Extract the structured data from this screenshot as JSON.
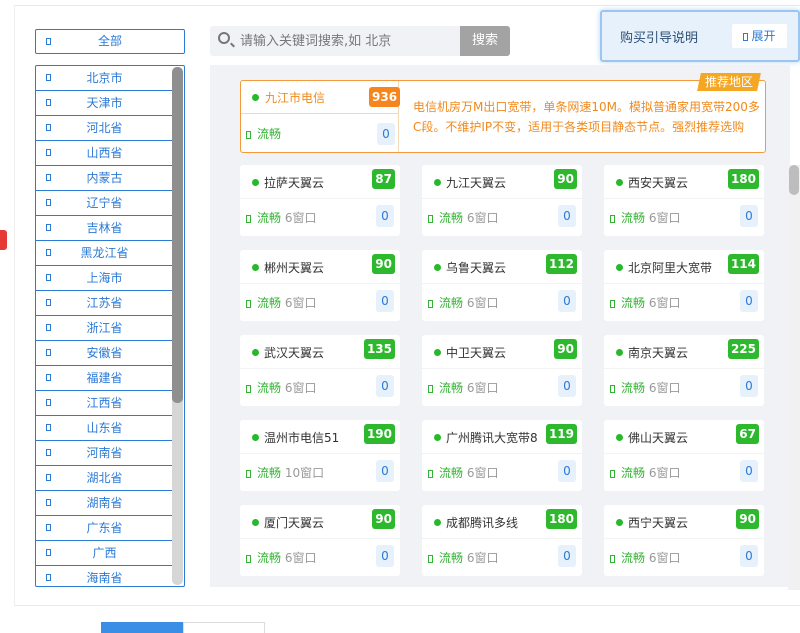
{
  "sidebar": {
    "all_label": "全部",
    "provinces": [
      "北京市",
      "天津市",
      "河北省",
      "山西省",
      "内蒙古",
      "辽宁省",
      "吉林省",
      "黑龙江省",
      "上海市",
      "江苏省",
      "浙江省",
      "安徽省",
      "福建省",
      "江西省",
      "山东省",
      "河南省",
      "湖北省",
      "湖南省",
      "广东省",
      "广西",
      "海南省"
    ]
  },
  "search": {
    "placeholder": "请输入关键词搜索,如 北京",
    "button_label": "搜索"
  },
  "guide": {
    "title": "购买引导说明",
    "expand_label": "展开"
  },
  "featured": {
    "badge": "推荐地区",
    "name": "九江市电信",
    "score": "936",
    "status": "流畅",
    "count": "0",
    "description": "电信机房万M出口宽带，单条网速10M。模拟普通家用宽带200多C段。不维护IP不变，适用于各类项目静态节点。强烈推荐选购"
  },
  "nodes": [
    {
      "name": "拉萨天翼云",
      "score": "87",
      "status": "流畅",
      "window": "6窗口",
      "count": "0"
    },
    {
      "name": "九江天翼云",
      "score": "90",
      "status": "流畅",
      "window": "6窗口",
      "count": "0"
    },
    {
      "name": "西安天翼云",
      "score": "180",
      "status": "流畅",
      "window": "6窗口",
      "count": "0"
    },
    {
      "name": "郴州天翼云",
      "score": "90",
      "status": "流畅",
      "window": "6窗口",
      "count": "0"
    },
    {
      "name": "乌鲁天翼云",
      "score": "112",
      "status": "流畅",
      "window": "6窗口",
      "count": "0"
    },
    {
      "name": "北京阿里大宽带",
      "score": "114",
      "status": "流畅",
      "window": "6窗口",
      "count": "0"
    },
    {
      "name": "武汉天翼云",
      "score": "135",
      "status": "流畅",
      "window": "6窗口",
      "count": "0"
    },
    {
      "name": "中卫天翼云",
      "score": "90",
      "status": "流畅",
      "window": "6窗口",
      "count": "0"
    },
    {
      "name": "南京天翼云",
      "score": "225",
      "status": "流畅",
      "window": "6窗口",
      "count": "0"
    },
    {
      "name": "温州市电信51",
      "score": "190",
      "status": "流畅",
      "window": "10窗口",
      "count": "0"
    },
    {
      "name": "广州腾讯大宽带8",
      "score": "119",
      "status": "流畅",
      "window": "6窗口",
      "count": "0"
    },
    {
      "name": "佛山天翼云",
      "score": "67",
      "status": "流畅",
      "window": "6窗口",
      "count": "0"
    },
    {
      "name": "厦门天翼云",
      "score": "90",
      "status": "流畅",
      "window": "6窗口",
      "count": "0"
    },
    {
      "name": "成都腾讯多线",
      "score": "180",
      "status": "流畅",
      "window": "6窗口",
      "count": "0"
    },
    {
      "name": "西宁天翼云",
      "score": "90",
      "status": "流畅",
      "window": "6窗口",
      "count": "0"
    }
  ],
  "colors": {
    "accent": "#2b7ad6",
    "score_green": "#2eb82e",
    "featured_orange": "#f7851e",
    "status_green": "#34b234"
  }
}
